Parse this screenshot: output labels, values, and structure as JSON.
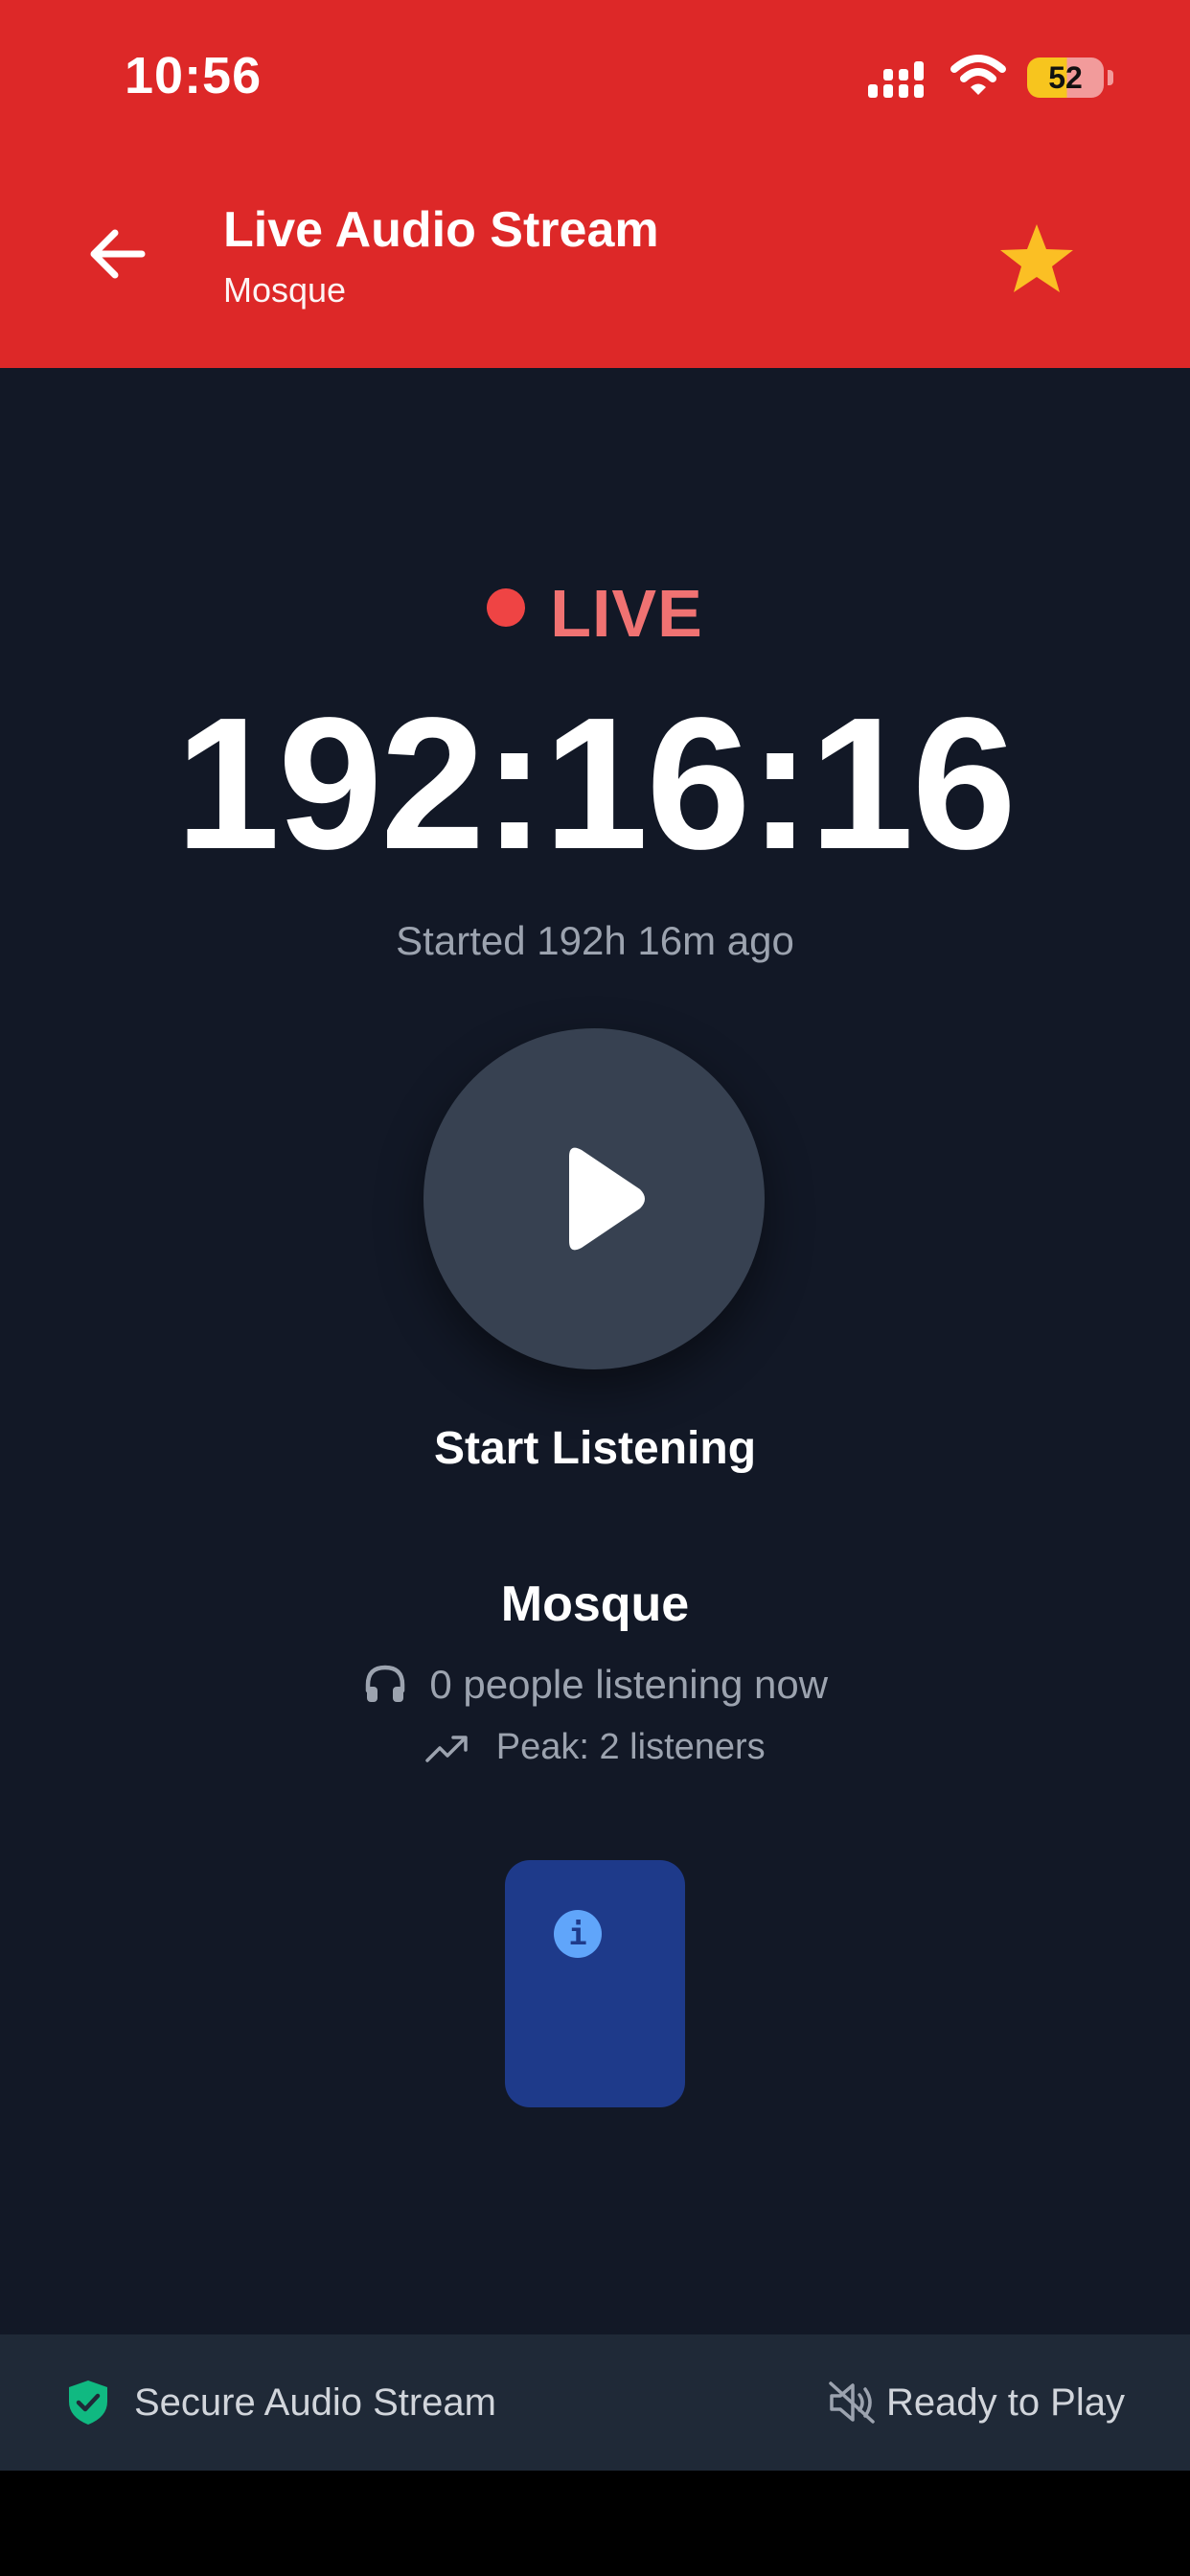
{
  "status_bar": {
    "time": "10:56",
    "battery_level": "52",
    "signal_icon": "cellular-signal-icon",
    "wifi_icon": "wifi-icon"
  },
  "header": {
    "title": "Live Audio Stream",
    "subtitle": "Mosque",
    "back_icon": "arrow-left-icon",
    "favorite_icon": "star-icon",
    "background_color": "#DD2828",
    "favorite_color": "#FBBF24"
  },
  "stream": {
    "live_label": "LIVE",
    "live_color": "#EF4444",
    "elapsed": "192:16:16",
    "started_text": "Started 192h 16m ago",
    "play_icon": "play-icon",
    "start_label": "Start Listening"
  },
  "station": {
    "name": "Mosque",
    "listeners_text": "0 people listening now",
    "listeners_icon": "headphones-icon",
    "peak_text": "Peak: 2 listeners",
    "peak_icon": "trending-up-icon"
  },
  "info_card": {
    "icon": "info-icon",
    "icon_glyph": "i",
    "background_color": "#1E3A8A"
  },
  "footer": {
    "secure_text": "Secure Audio Stream",
    "secure_icon": "shield-check-icon",
    "secure_color": "#10B981",
    "ready_text": "Ready to Play",
    "ready_icon": "speaker-muted-icon"
  },
  "theme": {
    "background": "#121826",
    "bottom_bar": "#1F2937",
    "play_button": "#374151"
  }
}
